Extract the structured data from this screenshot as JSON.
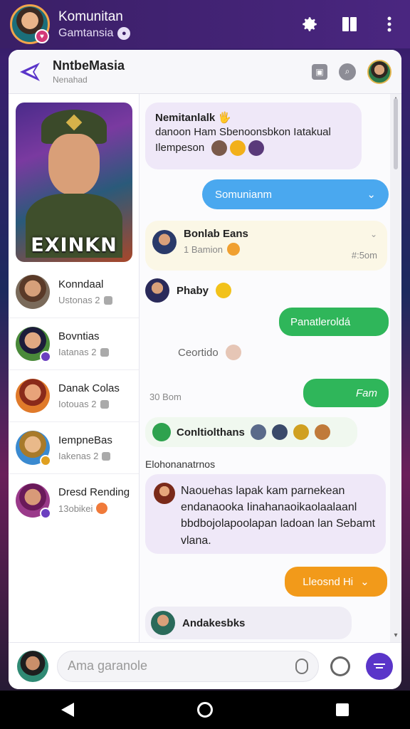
{
  "topbar": {
    "title": "Komunitan",
    "subtitle": "Gamtansia"
  },
  "card_header": {
    "title": "NntbeMasia",
    "subtitle": "Nenahad"
  },
  "hero": {
    "label": "EXINKN"
  },
  "contacts": [
    {
      "name": "Konndaal",
      "sub": "Ustonas 2"
    },
    {
      "name": "Bovntias",
      "sub": "Iatanas 2"
    },
    {
      "name": "Danak Colas",
      "sub": "Iotouas 2"
    },
    {
      "name": "IempneBas",
      "sub": "Iakenas 2"
    },
    {
      "name": "Dresd Rending",
      "sub": "13obikei"
    }
  ],
  "messages": {
    "m1": {
      "line1": "Nemitanlalk",
      "line2": "danoon Ham Sbenoonsbkon Iatakual",
      "line3": "Ilempeson"
    },
    "m2": {
      "text": "Somunianm"
    },
    "m3": {
      "name": "Bonlab Eans",
      "sub": "1 Bamion",
      "time": "#:5om"
    },
    "m4": {
      "text": "Phaby"
    },
    "m5": {
      "text": "Panatleroldá"
    },
    "m6": {
      "text": "Ceortido"
    },
    "m7": {
      "timestamp": "30 Bom",
      "text": "Fam"
    },
    "m8": {
      "text": "Conltiolthans"
    },
    "section": "Elohonanatrnos",
    "m9": {
      "text": "Naouehas lapak kam parnekean endanaooka Iinahanaoikaolaalaanl bbdbojolapoolapan ladoan lan Sebamt vlana."
    },
    "m10": {
      "text": "Lleosnd Hi"
    },
    "m11": {
      "text": "Andakesbks"
    }
  },
  "composer": {
    "placeholder": "Ama garanole"
  },
  "colors": {
    "accent": "#5a35c9",
    "blue_bubble": "#4aa8ef",
    "green_bubble": "#2fb65a",
    "orange_bubble": "#f29a1a"
  }
}
